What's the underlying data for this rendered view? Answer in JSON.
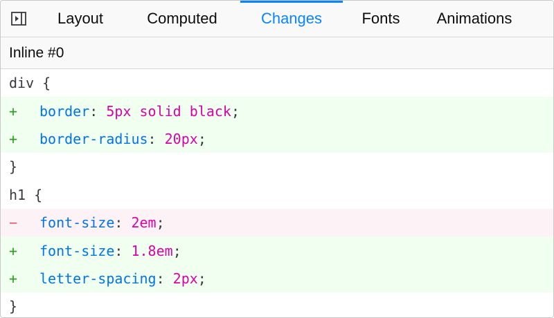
{
  "tabs": [
    {
      "label": "Layout",
      "selected": false
    },
    {
      "label": "Computed",
      "selected": false
    },
    {
      "label": "Changes",
      "selected": true
    },
    {
      "label": "Fonts",
      "selected": false
    },
    {
      "label": "Animations",
      "selected": false
    }
  ],
  "icons": {
    "sidebar_toggle": "sidebar-toggle-icon"
  },
  "source": {
    "label": "Inline #0"
  },
  "rules": [
    {
      "selector": "div {",
      "declarations": [
        {
          "type": "added",
          "marker": "+",
          "property": "border",
          "value": "5px solid black"
        },
        {
          "type": "added",
          "marker": "+",
          "property": "border-radius",
          "value": "20px"
        }
      ],
      "close": "}"
    },
    {
      "selector": "h1 {",
      "declarations": [
        {
          "type": "removed",
          "marker": "−",
          "property": "font-size",
          "value": "2em"
        },
        {
          "type": "added",
          "marker": "+",
          "property": "font-size",
          "value": "1.8em"
        },
        {
          "type": "added",
          "marker": "+",
          "property": "letter-spacing",
          "value": "2px"
        }
      ],
      "close": "}"
    }
  ],
  "colors": {
    "accent": "#0a84ff",
    "property": "#0074e8",
    "value": "#dd00a9",
    "added_bg": "#f0fff0",
    "removed_bg": "#fdf2f5",
    "added_marker": "#2e9d21",
    "removed_marker": "#e0566f"
  }
}
